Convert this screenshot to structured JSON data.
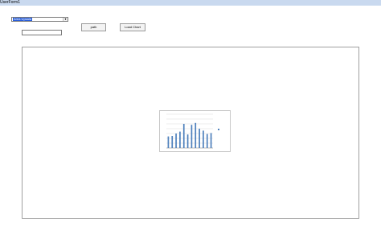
{
  "window": {
    "title": "UserForm1"
  },
  "form": {
    "combo_value": "Area Upsala",
    "textbox_value": "",
    "path_button": "path",
    "load_chart_button": "Load Chart"
  },
  "colors": {
    "titlebar": "#c9d9ef",
    "bar": "#4f81bd",
    "selection": "#2b5fd9"
  },
  "chart_data": {
    "type": "bar",
    "categories": [
      "Jan",
      "Feb",
      "Mar",
      "Apr",
      "May",
      "Jun",
      "Jul",
      "Aug",
      "Sep",
      "Oct",
      "Nov",
      "Dec"
    ],
    "series": [
      {
        "name": "",
        "values": [
          24,
          25,
          30,
          34,
          50,
          28,
          48,
          52,
          40,
          36,
          29,
          31
        ]
      }
    ],
    "ylim": [
      0,
      70
    ],
    "legend_position": "right",
    "grid": true
  }
}
